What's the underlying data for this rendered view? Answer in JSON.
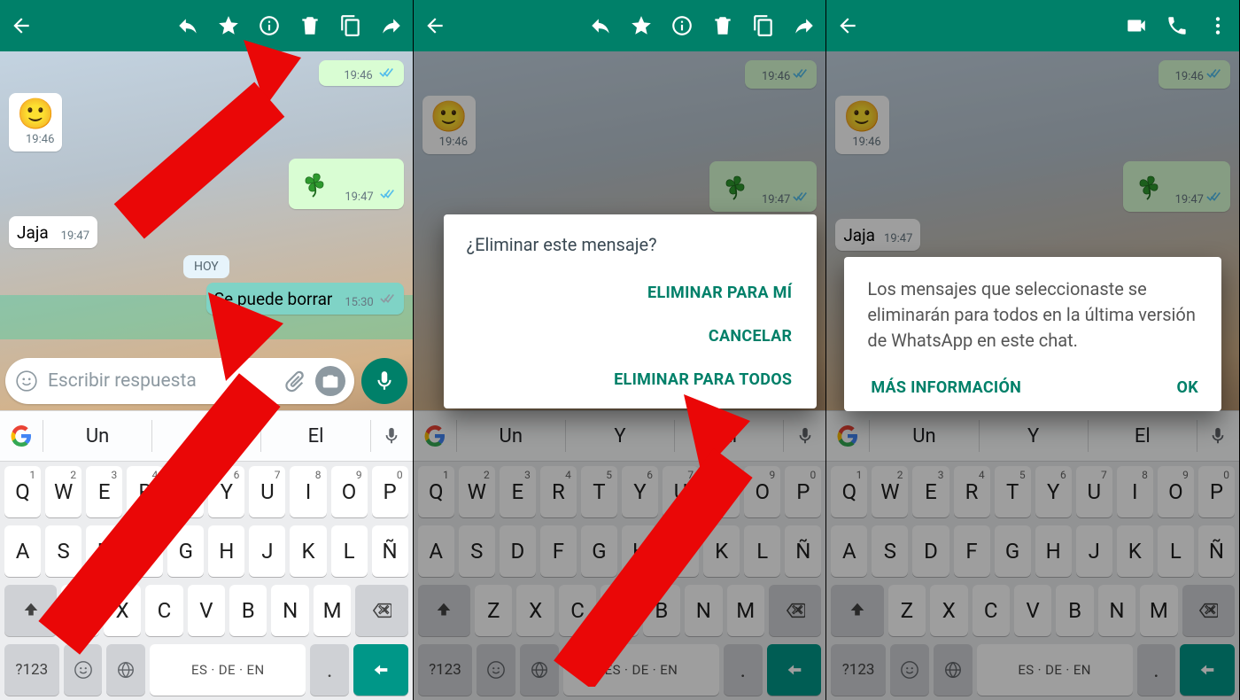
{
  "colors": {
    "primary": "#008069",
    "accent": "#009788",
    "arrow": "#ea0707"
  },
  "topbar_selection_icons": [
    "back",
    "reply",
    "star",
    "info",
    "trash",
    "copy",
    "forward"
  ],
  "topbar_chat_icons": [
    "back",
    "video",
    "phone",
    "more"
  ],
  "messages": {
    "m1_time": "19:46",
    "m2_emoji": "🙂",
    "m2_time": "19:46",
    "m3_emoji": "clover",
    "m3_time": "19:47",
    "m4_text": "Jaja",
    "m4_time": "19:47",
    "date_sep": "HOY",
    "m5_text": "Se puede borrar",
    "m5_time": "15:30"
  },
  "input": {
    "placeholder": "Escribir respuesta"
  },
  "suggestions": {
    "w1": "Un",
    "w2": "Y",
    "w3": "El"
  },
  "keyboard": {
    "row1": [
      {
        "k": "Q",
        "s": "1"
      },
      {
        "k": "W",
        "s": "2"
      },
      {
        "k": "E",
        "s": "3"
      },
      {
        "k": "R",
        "s": "4"
      },
      {
        "k": "T",
        "s": "5"
      },
      {
        "k": "Y",
        "s": "6"
      },
      {
        "k": "U",
        "s": "7"
      },
      {
        "k": "I",
        "s": "8"
      },
      {
        "k": "O",
        "s": "9"
      },
      {
        "k": "P",
        "s": "0"
      }
    ],
    "row2": [
      "A",
      "S",
      "D",
      "F",
      "G",
      "H",
      "J",
      "K",
      "L",
      "Ñ"
    ],
    "row3": [
      "Z",
      "X",
      "C",
      "V",
      "B",
      "N",
      "M"
    ],
    "numkey": "?123",
    "space": "ES · DE · EN"
  },
  "dialog_delete": {
    "title": "¿Eliminar este mensaje?",
    "opt_me": "ELIMINAR PARA MÍ",
    "opt_cancel": "CANCELAR",
    "opt_all": "ELIMINAR PARA TODOS"
  },
  "dialog_info": {
    "body": "Los mensajes que seleccionaste se eliminarán para todos en la última versión de WhatsApp en este chat.",
    "more": "MÁS INFORMACIÓN",
    "ok": "OK"
  }
}
